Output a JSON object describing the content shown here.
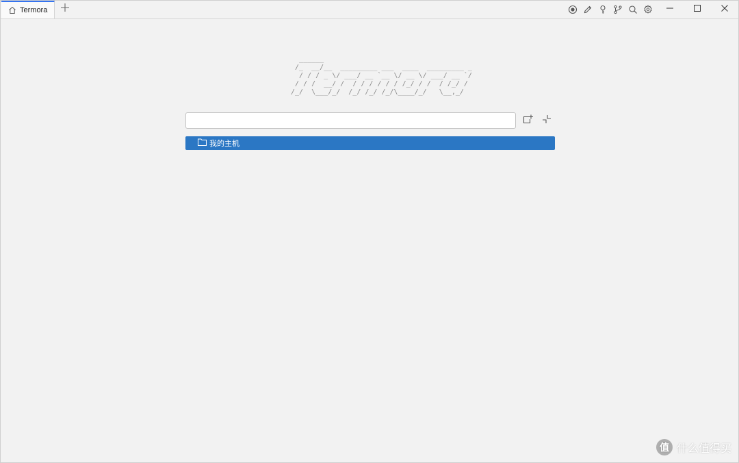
{
  "tab": {
    "title": "Termora",
    "icon": "home-icon"
  },
  "new_tab_icon": "plus-icon",
  "toolbar": {
    "icons": [
      "record-icon",
      "pencil-icon",
      "key-icon",
      "branch-icon",
      "search-icon",
      "gear-icon"
    ]
  },
  "window_controls": [
    "minimize-icon",
    "maximize-icon",
    "close-icon"
  ],
  "logo": {
    "ascii": "   ______\n  /_  __/__  _________ ___  ____  _________ _\n   / / / _ \\/ ___/ __ `__ \\/ __ \\/ ___/ __ `/\n  / / /  __/ /  / / / / / / /_/ / /  / /_/ /\n /_/  \\___/_/  /_/ /_/ /_/\\____/_/   \\__,_/"
  },
  "search": {
    "value": "",
    "placeholder": ""
  },
  "hosts": [
    {
      "label": "我的主机",
      "icon": "folder-icon"
    }
  ],
  "watermark": {
    "text": "什么值得买",
    "badge": "值"
  },
  "colors": {
    "accent": "#3574f0",
    "selection": "#2b77c4",
    "background": "#f2f2f2"
  }
}
